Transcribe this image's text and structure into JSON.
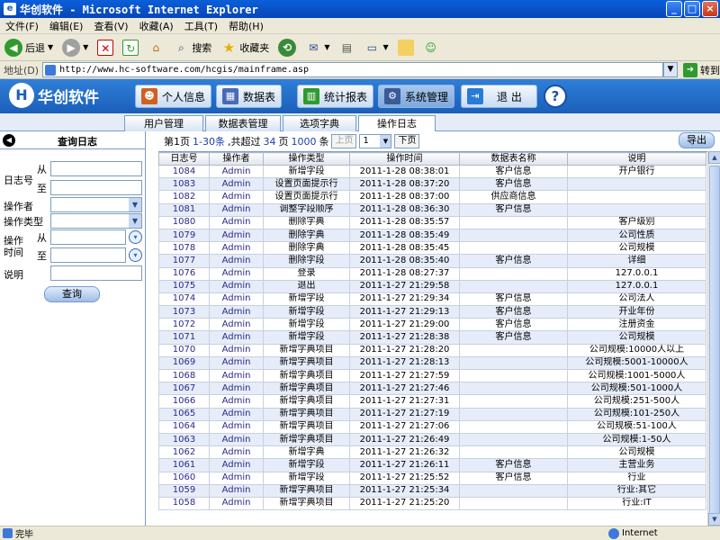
{
  "window": {
    "title": "华创软件 - Microsoft Internet Explorer",
    "controls": [
      "_",
      "□",
      "×"
    ]
  },
  "menu": [
    "文件(F)",
    "编辑(E)",
    "查看(V)",
    "收藏(A)",
    "工具(T)",
    "帮助(H)"
  ],
  "ie_toolbar": {
    "back": "后退",
    "search": "搜索",
    "favorites": "收藏夹"
  },
  "address": {
    "label": "地址(D)",
    "url": "http://www.hc-software.com/hcgis/mainframe.asp",
    "go": "转到"
  },
  "app": {
    "logo": "华创软件",
    "nav": [
      "个人信息",
      "数据表",
      "统计报表",
      "系统管理",
      "退 出"
    ],
    "help": "?",
    "subtabs": [
      "用户管理",
      "数据表管理",
      "选项字典",
      "操作日志"
    ]
  },
  "query": {
    "title": "查询日志",
    "log_no_label": "日志号",
    "from": "从",
    "to": "至",
    "operator_label": "操作者",
    "op_type_label": "操作类型",
    "op_time_label_1": "操作",
    "op_time_label_2": "时间",
    "desc_label": "说明",
    "submit": "查询"
  },
  "pager": {
    "page_text": "第1页",
    "range_text": "1-30条",
    "total_prefix": ",共超过",
    "pages_count": "34",
    "pages_unit": "页",
    "records_count": "1000",
    "records_unit": "条",
    "prev": "上页",
    "page_select": "1",
    "next": "下页",
    "export": "导出"
  },
  "table": {
    "headers": [
      "日志号",
      "操作者",
      "操作类型",
      "操作时间",
      "数据表名称",
      "说明"
    ],
    "rows": [
      [
        "1084",
        "Admin",
        "新增字段",
        "2011-1-28 08:38:01",
        "客户信息",
        "开户银行"
      ],
      [
        "1083",
        "Admin",
        "设置页面提示行",
        "2011-1-28 08:37:20",
        "客户信息",
        ""
      ],
      [
        "1082",
        "Admin",
        "设置页面提示行",
        "2011-1-28 08:37:00",
        "供应商信息",
        ""
      ],
      [
        "1081",
        "Admin",
        "调整字段顺序",
        "2011-1-28 08:36:30",
        "客户信息",
        ""
      ],
      [
        "1080",
        "Admin",
        "删除字典",
        "2011-1-28 08:35:57",
        "",
        "客户级别"
      ],
      [
        "1079",
        "Admin",
        "删除字典",
        "2011-1-28 08:35:49",
        "",
        "公司性质"
      ],
      [
        "1078",
        "Admin",
        "删除字典",
        "2011-1-28 08:35:45",
        "",
        "公司规模"
      ],
      [
        "1077",
        "Admin",
        "删除字段",
        "2011-1-28 08:35:40",
        "客户信息",
        "详细"
      ],
      [
        "1076",
        "Admin",
        "登录",
        "2011-1-28 08:27:37",
        "",
        "127.0.0.1"
      ],
      [
        "1075",
        "Admin",
        "退出",
        "2011-1-27 21:29:58",
        "",
        "127.0.0.1"
      ],
      [
        "1074",
        "Admin",
        "新增字段",
        "2011-1-27 21:29:34",
        "客户信息",
        "公司法人"
      ],
      [
        "1073",
        "Admin",
        "新增字段",
        "2011-1-27 21:29:13",
        "客户信息",
        "开业年份"
      ],
      [
        "1072",
        "Admin",
        "新增字段",
        "2011-1-27 21:29:00",
        "客户信息",
        "注册资金"
      ],
      [
        "1071",
        "Admin",
        "新增字段",
        "2011-1-27 21:28:38",
        "客户信息",
        "公司规模"
      ],
      [
        "1070",
        "Admin",
        "新增字典项目",
        "2011-1-27 21:28:20",
        "",
        "公司规模:10000人以上"
      ],
      [
        "1069",
        "Admin",
        "新增字典项目",
        "2011-1-27 21:28:13",
        "",
        "公司规模:5001-10000人"
      ],
      [
        "1068",
        "Admin",
        "新增字典项目",
        "2011-1-27 21:27:59",
        "",
        "公司规模:1001-5000人"
      ],
      [
        "1067",
        "Admin",
        "新增字典项目",
        "2011-1-27 21:27:46",
        "",
        "公司规模:501-1000人"
      ],
      [
        "1066",
        "Admin",
        "新增字典项目",
        "2011-1-27 21:27:31",
        "",
        "公司规模:251-500人"
      ],
      [
        "1065",
        "Admin",
        "新增字典项目",
        "2011-1-27 21:27:19",
        "",
        "公司规模:101-250人"
      ],
      [
        "1064",
        "Admin",
        "新增字典项目",
        "2011-1-27 21:27:06",
        "",
        "公司规模:51-100人"
      ],
      [
        "1063",
        "Admin",
        "新增字典项目",
        "2011-1-27 21:26:49",
        "",
        "公司规模:1-50人"
      ],
      [
        "1062",
        "Admin",
        "新增字典",
        "2011-1-27 21:26:32",
        "",
        "公司规模"
      ],
      [
        "1061",
        "Admin",
        "新增字段",
        "2011-1-27 21:26:11",
        "客户信息",
        "主营业务"
      ],
      [
        "1060",
        "Admin",
        "新增字段",
        "2011-1-27 21:25:52",
        "客户信息",
        "行业"
      ],
      [
        "1059",
        "Admin",
        "新增字典项目",
        "2011-1-27 21:25:34",
        "",
        "行业:其它"
      ],
      [
        "1058",
        "Admin",
        "新增字典项目",
        "2011-1-27 21:25:20",
        "",
        "行业:IT"
      ]
    ]
  },
  "status": {
    "text": "完毕",
    "zone": "Internet"
  },
  "colors": {
    "header_blue": "#1a5fba",
    "alt_row": "#e6ecf8",
    "id_text": "#2a2a8a"
  }
}
